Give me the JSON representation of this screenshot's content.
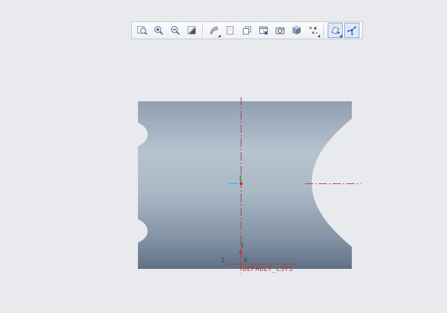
{
  "app": {
    "background": "#e9eaee"
  },
  "toolbar": {
    "icons": [
      {
        "name": "zoom-window"
      },
      {
        "name": "zoom-in"
      },
      {
        "name": "zoom-out"
      },
      {
        "name": "repaint"
      },
      {
        "name": "shade"
      },
      {
        "name": "display-style"
      },
      {
        "name": "layer-display"
      },
      {
        "name": "view-manager"
      },
      {
        "name": "saved-views"
      },
      {
        "name": "shaded-model"
      },
      {
        "name": "datum-point-display"
      },
      {
        "name": "datum-display",
        "active": true
      },
      {
        "name": "spin-center",
        "active": true
      }
    ]
  },
  "viewport": {
    "axis_labels": {
      "y": "Y",
      "x": "X",
      "z": "Z"
    },
    "csys_label": "DEFAULT_CSYS",
    "colors": {
      "model_top": "#909eb0",
      "model_mid": "#b7c3d1",
      "model_lower": "#7e8ea1",
      "model_bottom": "#5f7086",
      "centerline": "#9a4a42",
      "csys_line": "#b04040",
      "csys_text": "#a93b36",
      "axis_letter": "#3c3c3c",
      "triad_green": "#2fae2f",
      "triad_cyan": "#35cbe0",
      "triad_red": "#d02525"
    }
  }
}
